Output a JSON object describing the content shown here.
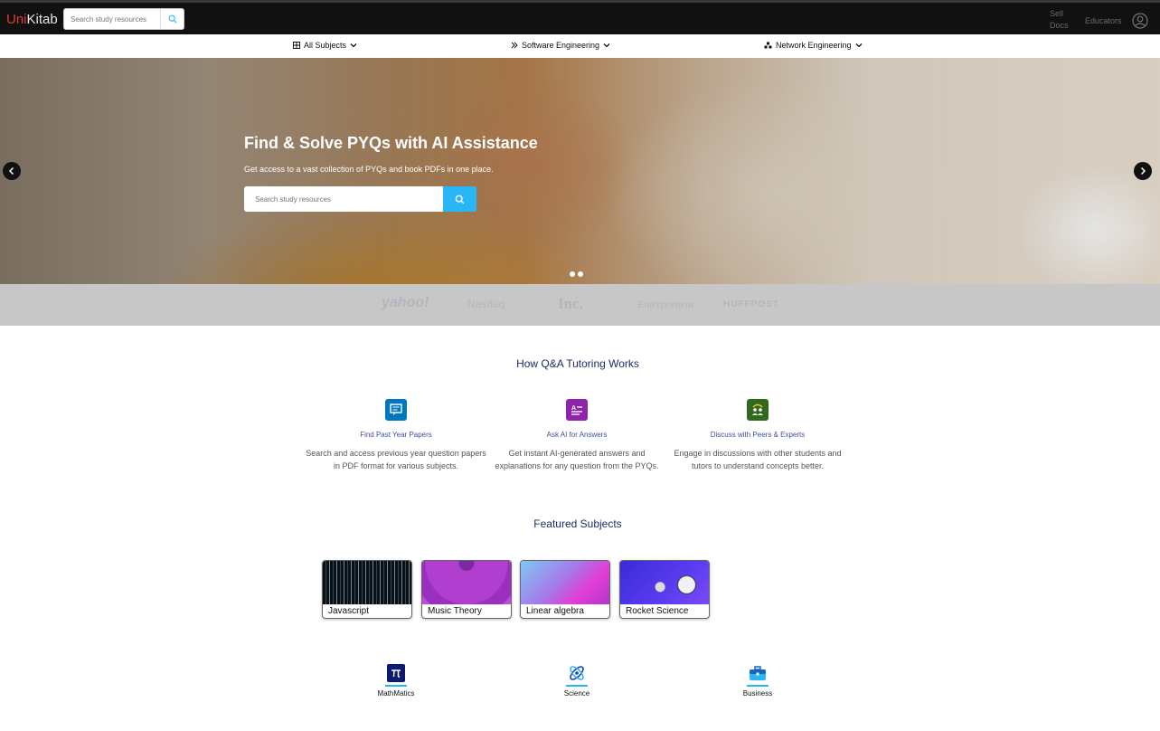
{
  "header": {
    "brand_first": "Uni",
    "brand_second": "Kitab",
    "search_placeholder": "Search study resources",
    "sell_line1": "Sell",
    "sell_line2": "Docs",
    "educators": "Educators"
  },
  "category_nav": [
    {
      "label": "All Subjects",
      "icon": "grid-icon"
    },
    {
      "label": "Software Engineering",
      "icon": "code-icon"
    },
    {
      "label": "Network Engineering",
      "icon": "network-icon"
    }
  ],
  "hero": {
    "title": "Find & Solve PYQs with AI Assistance",
    "subtitle": "Get access to a vast collection of PYQs and book PDFs in one place.",
    "search_placeholder": "Search study resources",
    "slides": 2
  },
  "press_logos": [
    "yahoo!",
    "Nasdaq",
    "Inc.",
    "Entrepreneur",
    "HUFFPOST"
  ],
  "how_it_works": {
    "title": "How Q&A Tutoring Works",
    "steps": [
      {
        "title": "Find Past Year Papers",
        "desc_1": "Search and access previous year question papers",
        "desc_2": "in PDF format for various subjects.",
        "icon": "papers-icon",
        "color": "#0277bd"
      },
      {
        "title": "Ask AI for Answers",
        "desc_1": "Get instant AI-generated answers and",
        "desc_2": "explanations for any question from the PYQs.",
        "icon": "ai-answers-icon",
        "color": "#8e24aa"
      },
      {
        "title": "Discuss with Peers & Experts",
        "desc_1": "Engage in discussions with other students and",
        "desc_2": "tutors to understand concepts better.",
        "icon": "discussion-icon",
        "color": "#33691e"
      }
    ]
  },
  "featured": {
    "title": "Featured Subjects",
    "cards": [
      "Javascript",
      "Music Theory",
      "Linear algebra",
      "Rocket Science"
    ]
  },
  "subjects": [
    {
      "label": "MathMatics",
      "icon": "pi-icon"
    },
    {
      "label": "Science",
      "icon": "atom-icon"
    },
    {
      "label": "Business",
      "icon": "briefcase-icon"
    }
  ]
}
